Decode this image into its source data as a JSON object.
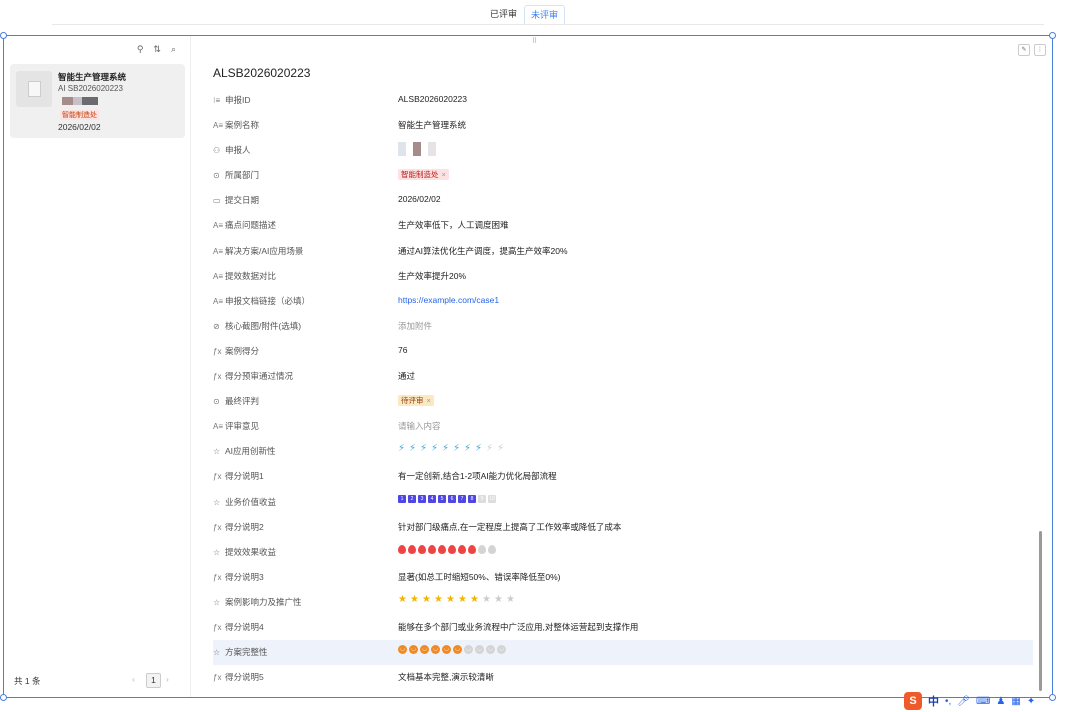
{
  "tabs": [
    {
      "label": "已评审",
      "active": false
    },
    {
      "label": "未评审",
      "active": true
    }
  ],
  "left_panel": {
    "tools": [
      "filter-icon",
      "sort-icon",
      "search-icon"
    ],
    "card": {
      "title": "智能生产管理系统",
      "id": "AI SB2026020223",
      "tag": "智能制造处",
      "date": "2026/02/02"
    },
    "pager": {
      "total": "共 1 条",
      "page": "1",
      "prev": "‹",
      "next": "›"
    }
  },
  "record": {
    "title": "ALSB2026020223",
    "rows": [
      {
        "icon": "list-icon",
        "glyph": "⁝≡",
        "label": "申报ID",
        "type": "text",
        "value": "ALSB2026020223"
      },
      {
        "icon": "text-icon",
        "glyph": "A≡",
        "label": "案例名称",
        "type": "text",
        "value": "智能生产管理系统"
      },
      {
        "icon": "person-icon",
        "glyph": "⚇",
        "label": "申报人",
        "type": "avatar",
        "value": ""
      },
      {
        "icon": "option-icon",
        "glyph": "⊙",
        "label": "所属部门",
        "type": "tag",
        "tag_color": "pink",
        "value": "智能制造处"
      },
      {
        "icon": "calendar-icon",
        "glyph": "▭",
        "label": "提交日期",
        "type": "text",
        "value": "2026/02/02"
      },
      {
        "icon": "text-icon",
        "glyph": "A≡",
        "label": "痛点问题描述",
        "type": "text",
        "value": "生产效率低下，人工调度困难"
      },
      {
        "icon": "text-icon",
        "glyph": "A≡",
        "label": "解决方案/AI应用场景",
        "type": "text",
        "value": "通过AI算法优化生产调度，提高生产效率20%"
      },
      {
        "icon": "text-icon",
        "glyph": "A≡",
        "label": "提效数据对比",
        "type": "text",
        "value": "生产效率提升20%"
      },
      {
        "icon": "text-icon",
        "glyph": "A≡",
        "label": "申报文档链接（必填）",
        "type": "link",
        "value": "https://example.com/case1"
      },
      {
        "icon": "attachment-icon",
        "glyph": "⊘",
        "label": "核心截图/附件(选填)",
        "type": "muted",
        "value": "添加附件"
      },
      {
        "icon": "formula-icon",
        "glyph": "ƒx",
        "label": "案例得分",
        "type": "text",
        "value": "76"
      },
      {
        "icon": "formula-icon",
        "glyph": "ƒx",
        "label": "得分预审通过情况",
        "type": "text",
        "value": "通过"
      },
      {
        "icon": "option-icon",
        "glyph": "⊙",
        "label": "最终评判",
        "type": "tag",
        "tag_color": "yellow",
        "value": "待评审"
      },
      {
        "icon": "text-icon",
        "glyph": "A≡",
        "label": "评审意见",
        "type": "muted",
        "value": "请输入内容"
      },
      {
        "icon": "star-outline-icon",
        "glyph": "☆",
        "label": "AI应用创新性",
        "type": "rating",
        "style": "bolt",
        "score": 8,
        "max": 10
      },
      {
        "icon": "formula-icon",
        "glyph": "ƒx",
        "label": "得分说明1",
        "type": "text",
        "value": "有一定创新,结合1-2项AI能力优化局部流程"
      },
      {
        "icon": "star-outline-icon",
        "glyph": "☆",
        "label": "业务价值收益",
        "type": "rating",
        "style": "square",
        "score": 8,
        "max": 10
      },
      {
        "icon": "formula-icon",
        "glyph": "ƒx",
        "label": "得分说明2",
        "type": "text",
        "value": "针对部门级痛点,在一定程度上提高了工作效率或降低了成本"
      },
      {
        "icon": "star-outline-icon",
        "glyph": "☆",
        "label": "提效效果收益",
        "type": "rating",
        "style": "flame",
        "score": 8,
        "max": 10
      },
      {
        "icon": "formula-icon",
        "glyph": "ƒx",
        "label": "得分说明3",
        "type": "text",
        "value": "显著(如总工时缩短50%、错误率降低至0%)"
      },
      {
        "icon": "star-outline-icon",
        "glyph": "☆",
        "label": "案例影响力及推广性",
        "type": "rating",
        "style": "star",
        "score": 7,
        "max": 10
      },
      {
        "icon": "formula-icon",
        "glyph": "ƒx",
        "label": "得分说明4",
        "type": "text",
        "value": "能够在多个部门或业务流程中广泛应用,对整体运营起到支撑作用"
      },
      {
        "icon": "star-outline-icon",
        "glyph": "☆",
        "label": "方案完整性",
        "type": "rating",
        "style": "smile",
        "score": 6,
        "max": 10,
        "highlight": true
      },
      {
        "icon": "formula-icon",
        "glyph": "ƒx",
        "label": "得分说明5",
        "type": "text",
        "value": "文档基本完整,演示较清晰"
      }
    ]
  },
  "ime": {
    "logo": "S",
    "lang": "中",
    "punct": "•,"
  },
  "colors": {
    "accent": "#3b82f6",
    "frame": "#4a7fe0",
    "tag_pink": "#fde2e2",
    "tag_yellow": "#fbe9c3"
  }
}
